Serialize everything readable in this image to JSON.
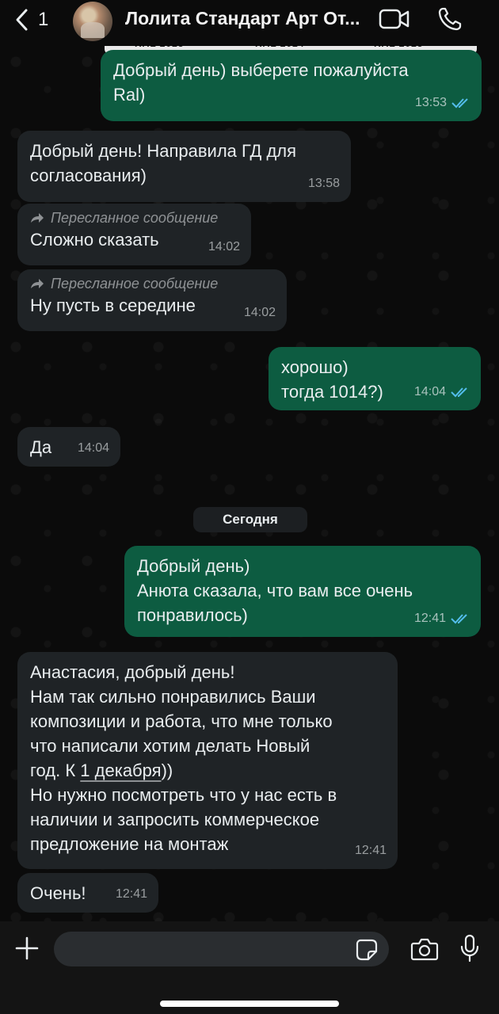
{
  "header": {
    "back_count": "1",
    "title": "Лолита Стандарт Арт От...",
    "video_icon": "video-call-icon",
    "phone_icon": "phone-icon",
    "back_icon": "chevron-left-icon"
  },
  "colors": {
    "outgoing_bubble": "#0d5c41",
    "incoming_bubble": "#1f2326",
    "background": "#0b0b0b",
    "read_tick": "#53bdeb"
  },
  "messages": [
    {
      "dir": "out",
      "text": "Добрый день) выберете пожалуйста\nRal)",
      "time": "13:53",
      "read": true
    },
    {
      "dir": "in",
      "text": "Добрый день! Направила ГД для\nсогласования)",
      "time": "13:58"
    },
    {
      "dir": "in",
      "forwarded": "Пересланное сообщение",
      "text": "Сложно сказать",
      "time": "14:02"
    },
    {
      "dir": "in",
      "forwarded": "Пересланное сообщение",
      "text": "Ну пусть в середине",
      "time": "14:02"
    },
    {
      "dir": "out",
      "text": "хорошо)\nтогда 1014?)",
      "time": "14:04",
      "read": true
    },
    {
      "dir": "in",
      "text": "Да",
      "time": "14:04"
    },
    {
      "dir": "out",
      "text": "Добрый день)\nАнюта сказала, что вам все очень\nпонравилось)",
      "time": "12:41",
      "read": true
    },
    {
      "dir": "in",
      "text_before": "Анастасия, добрый день!\nНам так сильно понравились Ваши\nкомпозиции и работа, что мне только\nчто написали хотим делать Новый\nгод. К ",
      "text_link": "1 декабря",
      "text_after": "))\nНо нужно посмотреть что у нас есть в\nналичии и запросить коммерческое\nпредложение на монтаж",
      "time": "12:41"
    },
    {
      "dir": "in",
      "text": "Очень!",
      "time": "12:41"
    }
  ],
  "date_separator": "Сегодня",
  "composer": {
    "placeholder": "",
    "plus_icon": "plus-icon",
    "sticker_icon": "sticker-icon",
    "camera_icon": "camera-icon",
    "mic_icon": "microphone-icon"
  }
}
